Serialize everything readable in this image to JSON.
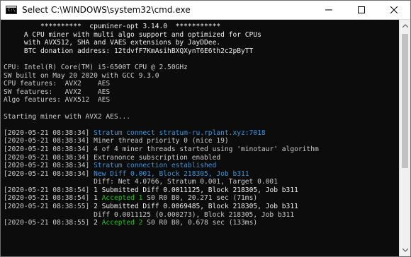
{
  "window": {
    "title": "Select C:\\WINDOWS\\system32\\cmd.exe",
    "icon_text": "C:\\"
  },
  "console": {
    "lines": [
      [
        {
          "t": "         **********  cpuminer-opt 3.14.0  ***********",
          "c": "white"
        }
      ],
      [
        {
          "t": "     A CPU miner with multi algo support and optimized for CPUs",
          "c": "white"
        }
      ],
      [
        {
          "t": "     with AVX512, SHA and VAES extensions by JayDDee.",
          "c": "white"
        }
      ],
      [
        {
          "t": "     BTC donation address: 12tdvfF7KmAsihBXQXynT6E6th2c2pByTT",
          "c": "white"
        }
      ],
      [
        {
          "t": "",
          "c": "gray"
        }
      ],
      [
        {
          "t": "CPU: Intel(R) Core(TM) i5-6500T CPU @ 2.50GHz",
          "c": "gray"
        }
      ],
      [
        {
          "t": "SW built on May 20 2020 with GCC 9.3.0",
          "c": "gray"
        }
      ],
      [
        {
          "t": "CPU features:  AVX2    AES",
          "c": "gray"
        }
      ],
      [
        {
          "t": "SW features:   AVX2    AES",
          "c": "gray"
        }
      ],
      [
        {
          "t": "Algo features: AVX512  AES",
          "c": "gray"
        }
      ],
      [
        {
          "t": "",
          "c": "gray"
        }
      ],
      [
        {
          "t": "Starting miner with AVX2 AES...",
          "c": "gray"
        }
      ],
      [
        {
          "t": "",
          "c": "gray"
        }
      ],
      [
        {
          "t": "[2020-05-21 08:38:34] ",
          "c": "gray"
        },
        {
          "t": "Stratum connect stratum-ru.rplant.xyz:7018",
          "c": "cyan"
        }
      ],
      [
        {
          "t": "[2020-05-21 08:38:34] Miner thread priority 0 (nice 19)",
          "c": "gray"
        }
      ],
      [
        {
          "t": "[2020-05-21 08:38:34] 4 of 4 miner threads started using 'minotaur' algorithm",
          "c": "gray"
        }
      ],
      [
        {
          "t": "[2020-05-21 08:38:34] Extranonce subscription enabled",
          "c": "gray"
        }
      ],
      [
        {
          "t": "[2020-05-21 08:38:34] ",
          "c": "gray"
        },
        {
          "t": "Stratum connection established",
          "c": "cyan"
        }
      ],
      [
        {
          "t": "[2020-05-21 08:38:34] ",
          "c": "gray"
        },
        {
          "t": "New Diff 0.001, Block 218305, Job b311",
          "c": "cyan"
        }
      ],
      [
        {
          "t": "                      Diff: Net 4.0766, Stratum 0.001, Target 0.001",
          "c": "gray"
        }
      ],
      [
        {
          "t": "[2020-05-21 08:38:54] ",
          "c": "gray"
        },
        {
          "t": "1 Submitted Diff 0.0011125, Block 218305, Job b311",
          "c": "white"
        }
      ],
      [
        {
          "t": "[2020-05-21 08:38:54] ",
          "c": "gray"
        },
        {
          "t": "1 ",
          "c": "white"
        },
        {
          "t": "Accepted 1",
          "c": "green"
        },
        {
          "t": " S0 R0 B0, 20.271 sec (71ms)",
          "c": "gray"
        }
      ],
      [
        {
          "t": "[2020-05-21 08:38:55] ",
          "c": "gray"
        },
        {
          "t": "2 Submitted Diff 0.0069485, Block 218305, Job b311",
          "c": "white"
        }
      ],
      [
        {
          "t": "                      Diff 0.0011125 (0.000273), Block 218305, Job b311",
          "c": "gray"
        }
      ],
      [
        {
          "t": "[2020-05-21 08:38:55] ",
          "c": "gray"
        },
        {
          "t": "2 ",
          "c": "white"
        },
        {
          "t": "Accepted 2",
          "c": "green"
        },
        {
          "t": " S0 R0 B0, 0.678 sec (133ms)",
          "c": "gray"
        }
      ]
    ]
  },
  "colors": {
    "background": "#0c0c0c",
    "gray": "#cccccc",
    "white": "#f2f2f2",
    "cyan": "#3a96dd",
    "green": "#16c60c"
  },
  "icons": {
    "app": "cmd-icon",
    "minimize": "minimize-icon",
    "maximize": "maximize-icon",
    "close": "close-icon",
    "scroll_up": "scroll-up-arrow-icon",
    "scroll_down": "scroll-down-arrow-icon"
  }
}
